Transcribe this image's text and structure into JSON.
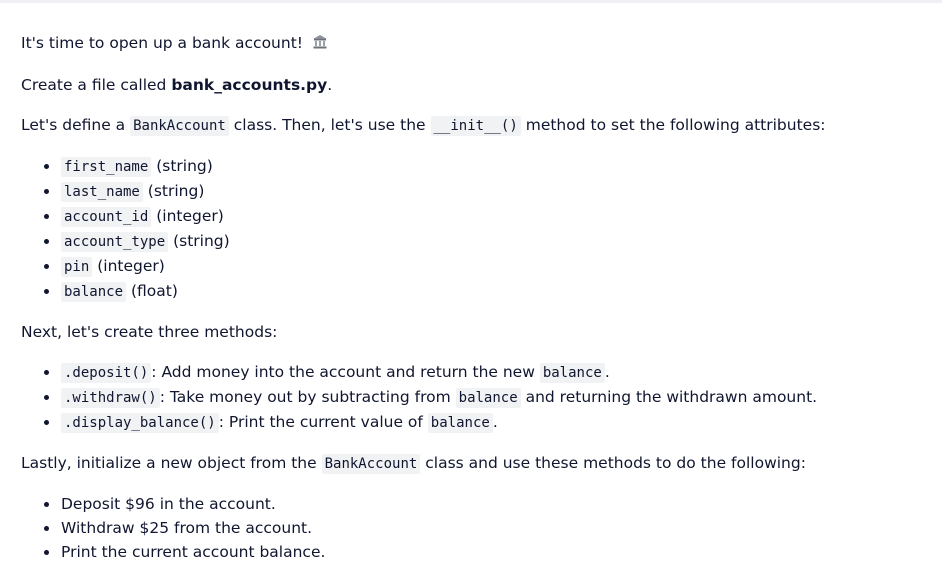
{
  "intro": {
    "text": "It's time to open up a bank account!",
    "icon": "bank-icon"
  },
  "create_file": {
    "prefix": "Create a file called ",
    "filename": "bank_accounts.py",
    "suffix": "."
  },
  "define": {
    "t1": "Let's define a ",
    "class_name": "BankAccount",
    "t2": " class. Then, let's use the ",
    "method": "__init__()",
    "t3": " method to set the following attributes:"
  },
  "attributes": [
    {
      "name": "first_name",
      "type": "(string)"
    },
    {
      "name": "last_name",
      "type": "(string)"
    },
    {
      "name": "account_id",
      "type": "(integer)"
    },
    {
      "name": "account_type",
      "type": "(string)"
    },
    {
      "name": "pin",
      "type": "(integer)"
    },
    {
      "name": "balance",
      "type": "(float)"
    }
  ],
  "methods_intro": "Next, let's create three methods:",
  "methods": [
    {
      "code": ".deposit()",
      "desc": ": Add money into the account and return the new ",
      "ref": "balance",
      "end": "."
    },
    {
      "code": ".withdraw()",
      "desc": ": Take money out by subtracting from ",
      "ref": "balance",
      "end": " and returning the withdrawn amount."
    },
    {
      "code": ".display_balance()",
      "desc": ": Print the current value of ",
      "ref": "balance",
      "end": "."
    }
  ],
  "lastly": {
    "t1": "Lastly, initialize a new object from the ",
    "class_name": "BankAccount",
    "t2": " class and use these methods to do the following:"
  },
  "steps": [
    "Deposit $96 in the account.",
    "Withdraw $25 from the account.",
    "Print the current account balance."
  ]
}
